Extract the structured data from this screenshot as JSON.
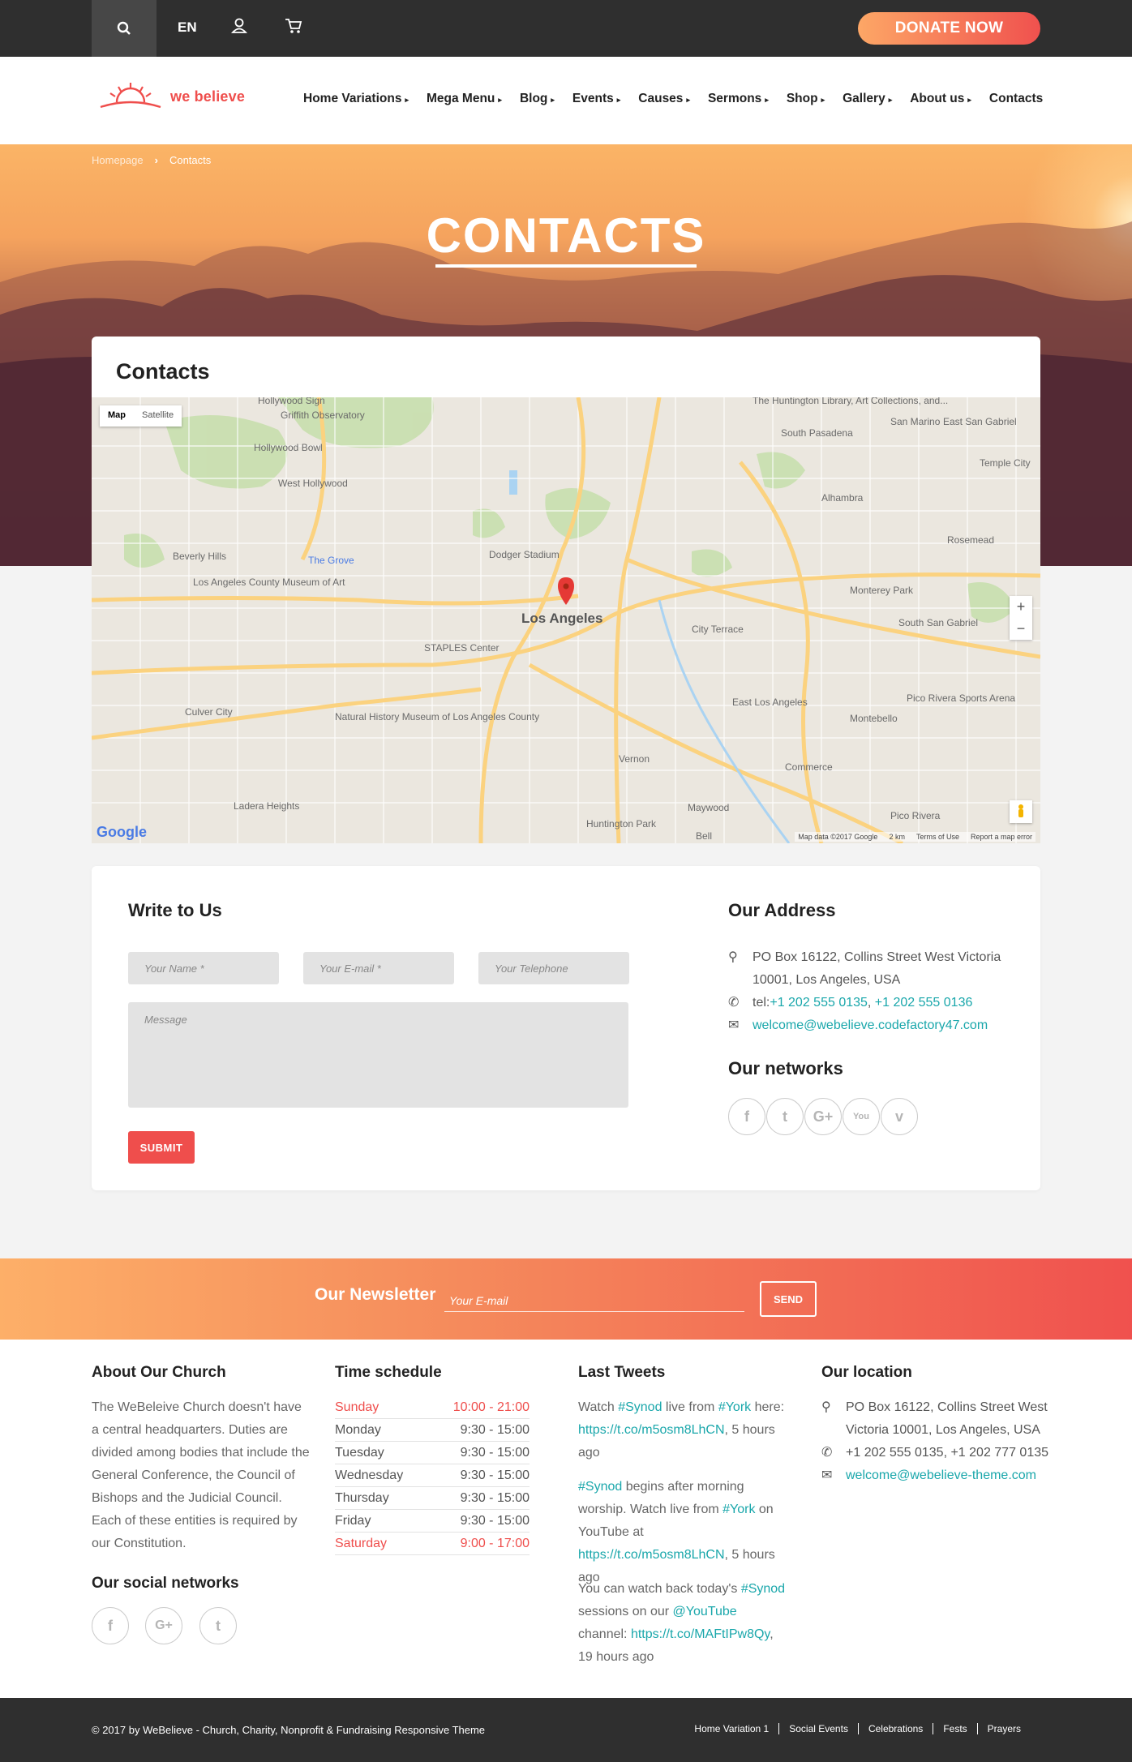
{
  "topbar": {
    "lang": "EN",
    "donate_label": "DONATE NOW"
  },
  "logo": {
    "text": "we believe"
  },
  "nav": [
    "Home Variations",
    "Mega Menu",
    "Blog",
    "Events",
    "Causes",
    "Sermons",
    "Shop",
    "Gallery",
    "About us",
    "Contacts"
  ],
  "breadcrumb": {
    "home": "Homepage",
    "current": "Contacts"
  },
  "hero": {
    "title": "CONTACTS"
  },
  "map_section": {
    "title": "Contacts",
    "type_map": "Map",
    "type_satellite": "Satellite",
    "zoom_in": "+",
    "zoom_out": "−",
    "google": "Google",
    "attribution": "Map data ©2017 Google",
    "scale": "2 km",
    "terms": "Terms of Use",
    "report": "Report a map error",
    "labels": {
      "la": "Los Angeles",
      "hollywood_sign": "Hollywood Sign",
      "griffith": "Griffith Observatory",
      "hollywood_bowl": "Hollywood Bowl",
      "west_hollywood": "West Hollywood",
      "beverly_hills": "Beverly Hills",
      "grove": "The Grove",
      "lacma": "Los Angeles County Museum of Art",
      "dodger": "Dodger Stadium",
      "staples": "STAPLES Center",
      "nhm": "Natural History Museum of Los Angeles County",
      "culver": "Culver City",
      "ladera": "Ladera Heights",
      "huntington": "Huntington Park",
      "alhambra": "Alhambra",
      "south_pasadena": "South Pasadena",
      "san_marino": "San Marino",
      "temple_city": "Temple City",
      "rosemead": "Rosemead",
      "monterey_park": "Monterey Park",
      "east_la": "East Los Angeles",
      "montebello": "Montebello",
      "commerce": "Commerce",
      "pico_rivera": "Pico Rivera",
      "pico_rivera_arena": "Pico Rivera Sports Arena",
      "vernon": "Vernon",
      "maywood": "Maywood",
      "bell": "Bell",
      "city_terrace": "City Terrace",
      "huntington_library": "The Huntington Library, Art Collections, and...",
      "south_san_gabriel": "South San Gabriel",
      "east_san_gabriel": "East San Gabriel"
    }
  },
  "form": {
    "title": "Write to Us",
    "name_ph": "Your Name *",
    "email_ph": "Your E-mail *",
    "tel_ph": "Your Telephone",
    "message_ph": "Message",
    "submit": "SUBMIT"
  },
  "address": {
    "title": "Our Address",
    "line1": "PO Box 16122, Collins Street West Victoria",
    "line2": "10001, Los Angeles, USA",
    "tel_prefix": "tel:",
    "tel1": "+1 202 555 0135",
    "tel_sep": ", ",
    "tel2": "+1 202 555 0136",
    "email": "welcome@webelieve.codefactory47.com",
    "networks_title": "Our networks"
  },
  "newsletter": {
    "title": "Our Newsletter",
    "placeholder": "Your E-mail",
    "send": "SEND"
  },
  "footer": {
    "about_title": "About Our Church",
    "about_text": "The WeBeleive Church doesn't have a central headquarters. Duties are divided among bodies that include the General Conference, the Council of Bishops and the Judicial Council. Each of these entities is required by our Constitution.",
    "social_title": "Our social networks",
    "schedule_title": "Time schedule",
    "schedule": [
      {
        "day": "Sunday",
        "time": "10:00 - 21:00"
      },
      {
        "day": "Monday",
        "time": "9:30 - 15:00"
      },
      {
        "day": "Tuesday",
        "time": "9:30 - 15:00"
      },
      {
        "day": "Wednesday",
        "time": "9:30 - 15:00"
      },
      {
        "day": "Thursday",
        "time": "9:30 - 15:00"
      },
      {
        "day": "Friday",
        "time": "9:30 - 15:00"
      },
      {
        "day": "Saturday",
        "time": "9:00 - 17:00"
      }
    ],
    "tweets_title": "Last Tweets",
    "tweets": [
      {
        "p1": "Watch ",
        "tag1": "#Synod",
        "p2": " live from ",
        "tag2": "#York",
        "p3": " here: ",
        "url": "https://t.co/m5osm8LhCN",
        "p4": ", 5 hours ago"
      },
      {
        "tag1": "#Synod",
        "p2": " begins after morning worship. Watch live from ",
        "tag2": "#York",
        "p3": " on YouTube at ",
        "url": "https://t.co/m5osm8LhCN",
        "p4": ", 5 hours ago"
      },
      {
        "p1": "You can watch back today's ",
        "tag1": "#Synod",
        "p2": " sessions on our ",
        "tag2": "@YouTube",
        "p3": " channel: ",
        "url": "https://t.co/MAFtIPw8Qy",
        "p4": ", 19 hours ago"
      }
    ],
    "location_title": "Our location",
    "loc_line": "PO Box 16122, Collins Street West Victoria 10001, Los Angeles, USA",
    "loc_phone": "+1 202 555 0135, +1 202 777 0135",
    "loc_email": "welcome@webelieve-theme.com"
  },
  "bottom": {
    "copyright": "© 2017 by WeBelieve - Church, Charity, Nonprofit & Fundraising Responsive Theme",
    "links": [
      "Home Variation 1",
      "Social Events",
      "Celebrations",
      "Fests",
      "Prayers"
    ]
  },
  "colors": {
    "accent": "#ef4e4c",
    "link": "#1aa7ab",
    "dark": "#2f2f2f",
    "orange": "#fdaf68"
  }
}
